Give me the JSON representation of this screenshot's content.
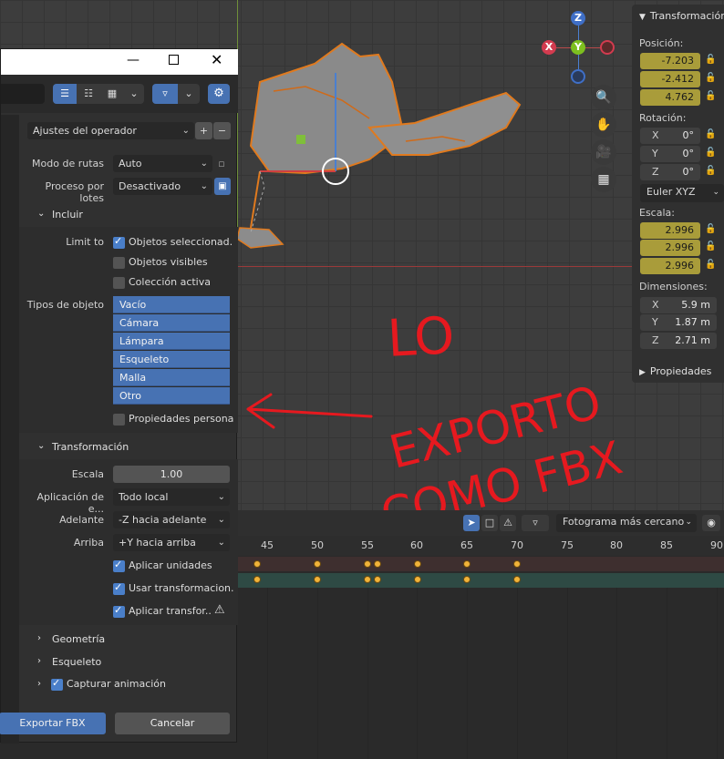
{
  "dialog": {
    "operator_preset": "Ajustes del operador",
    "path_mode_label": "Modo de rutas",
    "path_mode_value": "Auto",
    "batch_label": "Proceso por lotes",
    "batch_value": "Desactivado",
    "include_section": "Incluir",
    "limit_to_label": "Limit to",
    "selected_objects": "Objetos seleccionad...",
    "visible_objects": "Objetos visibles",
    "active_collection": "Colección activa",
    "object_types_label": "Tipos de objeto",
    "object_types": [
      "Vacío",
      "Cámara",
      "Lámpara",
      "Esqueleto",
      "Malla",
      "Otro"
    ],
    "custom_props": "Propiedades persona...",
    "transform_section": "Transformación",
    "scale_label": "Escala",
    "scale_value": "1.00",
    "apply_label": "Aplicación de e...",
    "apply_value": "Todo local",
    "forward_label": "Adelante",
    "forward_value": "-Z hacia adelante",
    "up_label": "Arriba",
    "up_value": "+Y hacia arriba",
    "apply_units": "Aplicar unidades",
    "use_transform": "Usar transformacion...",
    "apply_transform": "Aplicar transfor...",
    "geometry_section": "Geometría",
    "armature_section": "Esqueleto",
    "bake_section": "Capturar animación",
    "export_button": "Exportar FBX",
    "cancel_button": "Cancelar"
  },
  "npanel": {
    "title": "Transformación",
    "position_label": "Posición:",
    "position": [
      "-7.203",
      "-2.412",
      "4.762"
    ],
    "rotation_label": "Rotación:",
    "rotation": [
      {
        "axis": "X",
        "value": "0°"
      },
      {
        "axis": "Y",
        "value": "0°"
      },
      {
        "axis": "Z",
        "value": "0°"
      }
    ],
    "rotation_mode": "Euler XYZ",
    "scale_label": "Escala:",
    "scale": [
      "2.996",
      "2.996",
      "2.996"
    ],
    "dimensions_label": "Dimensiones:",
    "dimensions": [
      {
        "axis": "X",
        "value": "5.9 m"
      },
      {
        "axis": "Y",
        "value": "1.87 m"
      },
      {
        "axis": "Z",
        "value": "2.71 m"
      }
    ],
    "properties": "Propiedades"
  },
  "gizmo": {
    "x": "X",
    "y": "Y",
    "z": "Z"
  },
  "timeline": {
    "snap_mode": "Fotograma más cercano",
    "ticks": [
      "45",
      "50",
      "55",
      "60",
      "65",
      "70",
      "75",
      "80",
      "85",
      "90"
    ]
  },
  "annotation": {
    "line1": "LO",
    "line2": "EXPORTO",
    "line3": "COMO FBX"
  },
  "colors": {
    "accent": "#4772b3",
    "annotation": "#e6191f",
    "keyframe": "#f0b33a"
  }
}
